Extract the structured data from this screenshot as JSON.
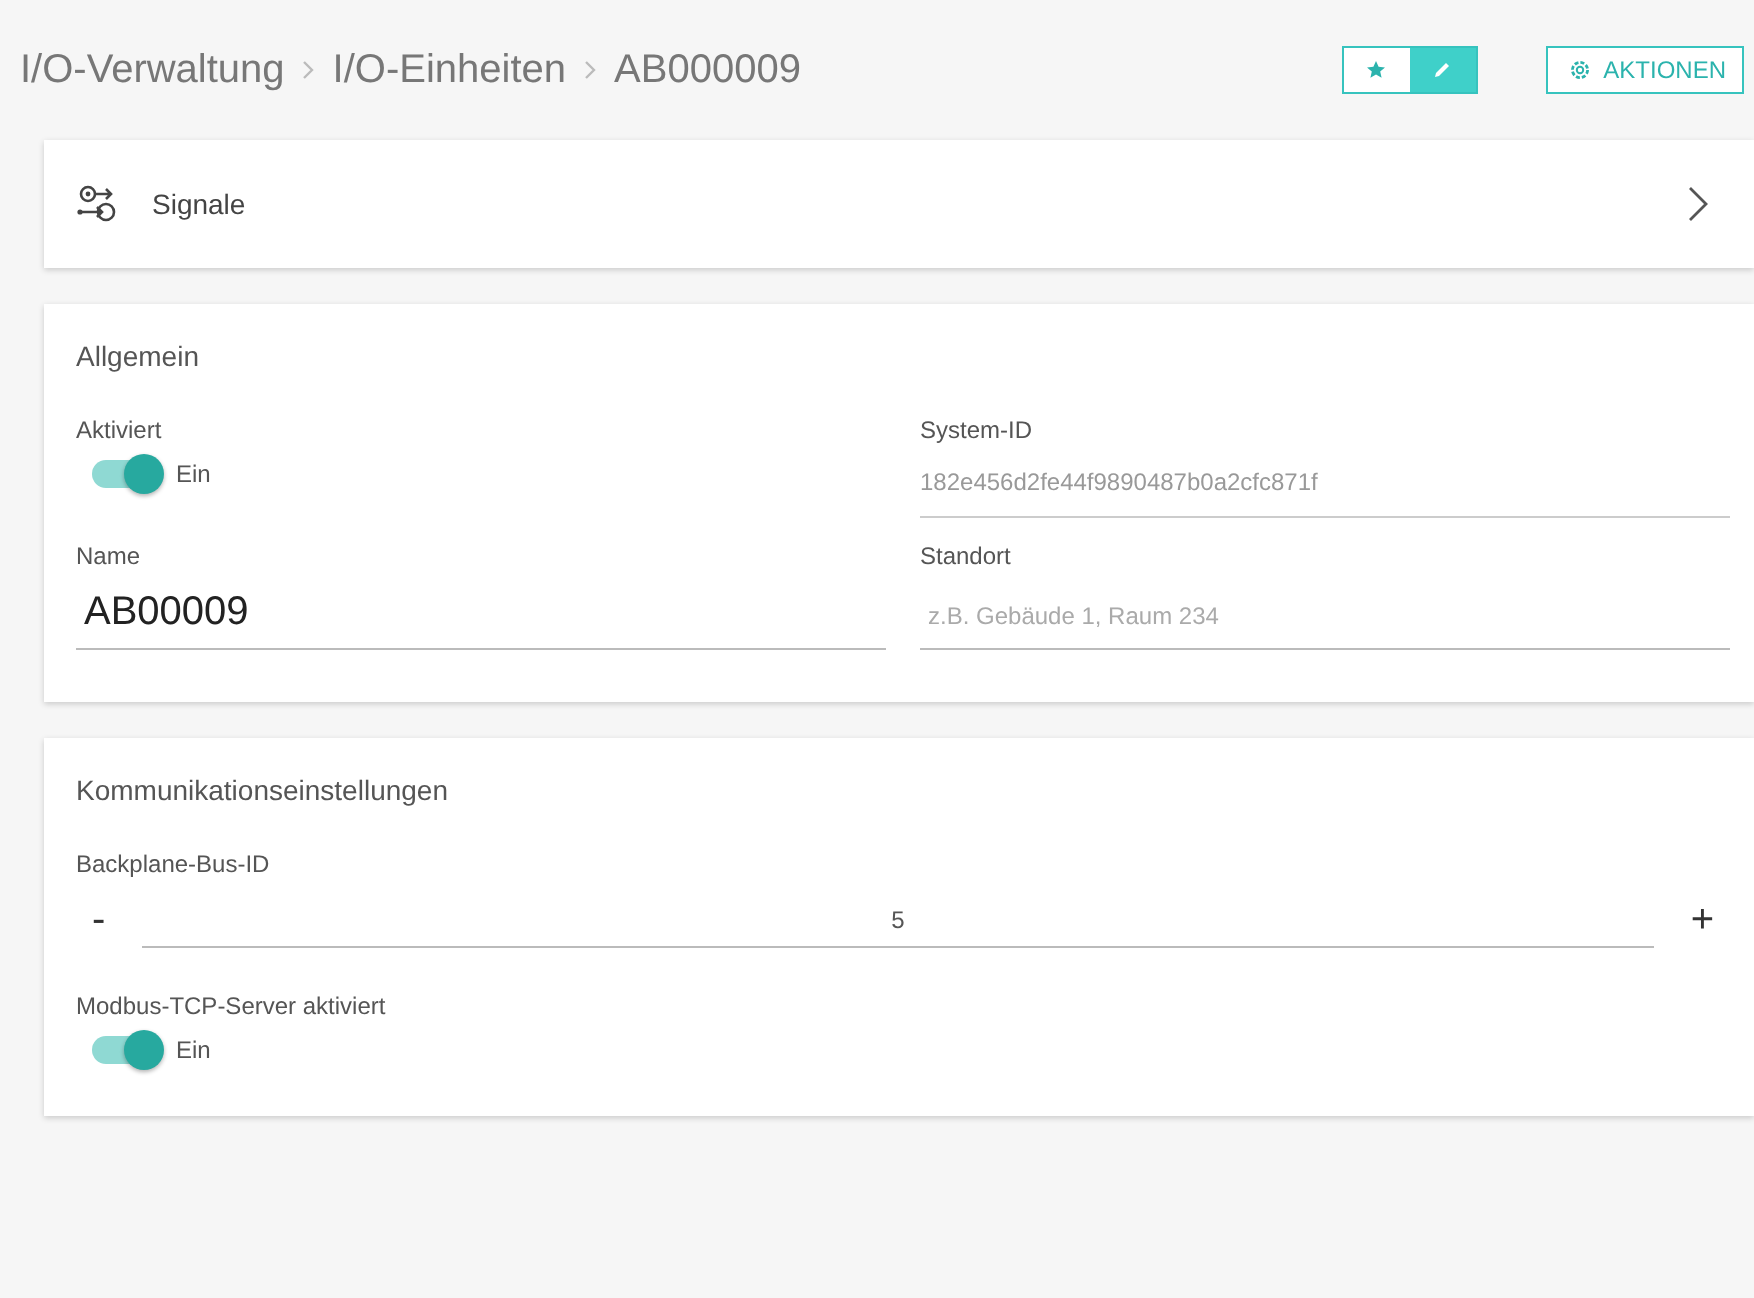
{
  "breadcrumb": [
    {
      "label": "I/O-Verwaltung"
    },
    {
      "label": "I/O-Einheiten"
    },
    {
      "label": "AB000009"
    }
  ],
  "header_buttons": {
    "favorite": {
      "selected": false
    },
    "edit": {
      "selected": true
    },
    "actions": {
      "label": "AKTIONEN"
    }
  },
  "signals_link": {
    "label": "Signale"
  },
  "sections": [
    {
      "title": "Allgemein",
      "fields": [
        {
          "kind": "toggle",
          "label": "Aktiviert",
          "on": true,
          "state_label": "Ein"
        },
        {
          "kind": "readonly",
          "label": "System-ID",
          "value": "182e456d2fe44f9890487b0a2cfc871f"
        },
        {
          "kind": "text",
          "label": "Name",
          "value": "AB00009"
        },
        {
          "kind": "text",
          "label": "Standort",
          "placeholder": "z.B. Gebäude 1, Raum 234"
        }
      ]
    },
    {
      "title": "Kommunikationseinstellungen",
      "fields": [
        {
          "kind": "stepper",
          "label": "Backplane-Bus-ID",
          "value": "5",
          "minus": "-",
          "plus": "+"
        },
        {
          "kind": "toggle",
          "label": "Modbus-TCP-Server aktiviert",
          "on": true,
          "state_label": "Ein"
        }
      ]
    }
  ]
}
